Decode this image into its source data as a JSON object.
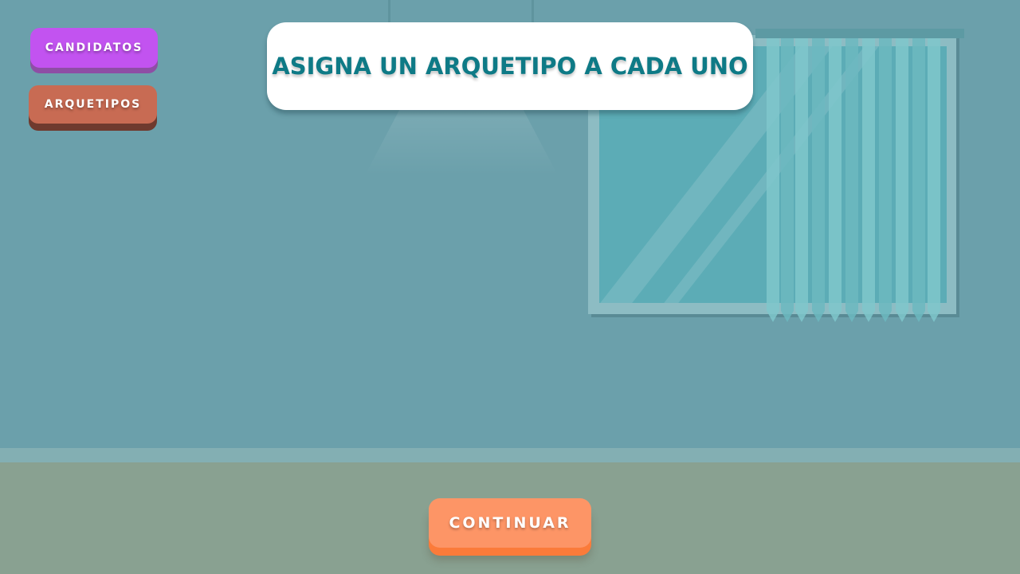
{
  "buttons": {
    "candidatos_label": "CANDIDATOS",
    "arquetipos_label": "ARQUETIPOS",
    "continue_label": "CONTINUAR"
  },
  "instruction": {
    "text": "ASIGNA UN ARQUETIPO A CADA UNO"
  },
  "colors": {
    "wall": "#6ba0ab",
    "floor": "#89a191",
    "candidatos_button": "#c253f0",
    "arquetipos_button": "#c86b53",
    "continue_button": "#fd9566",
    "title_text": "#0e7a86"
  }
}
